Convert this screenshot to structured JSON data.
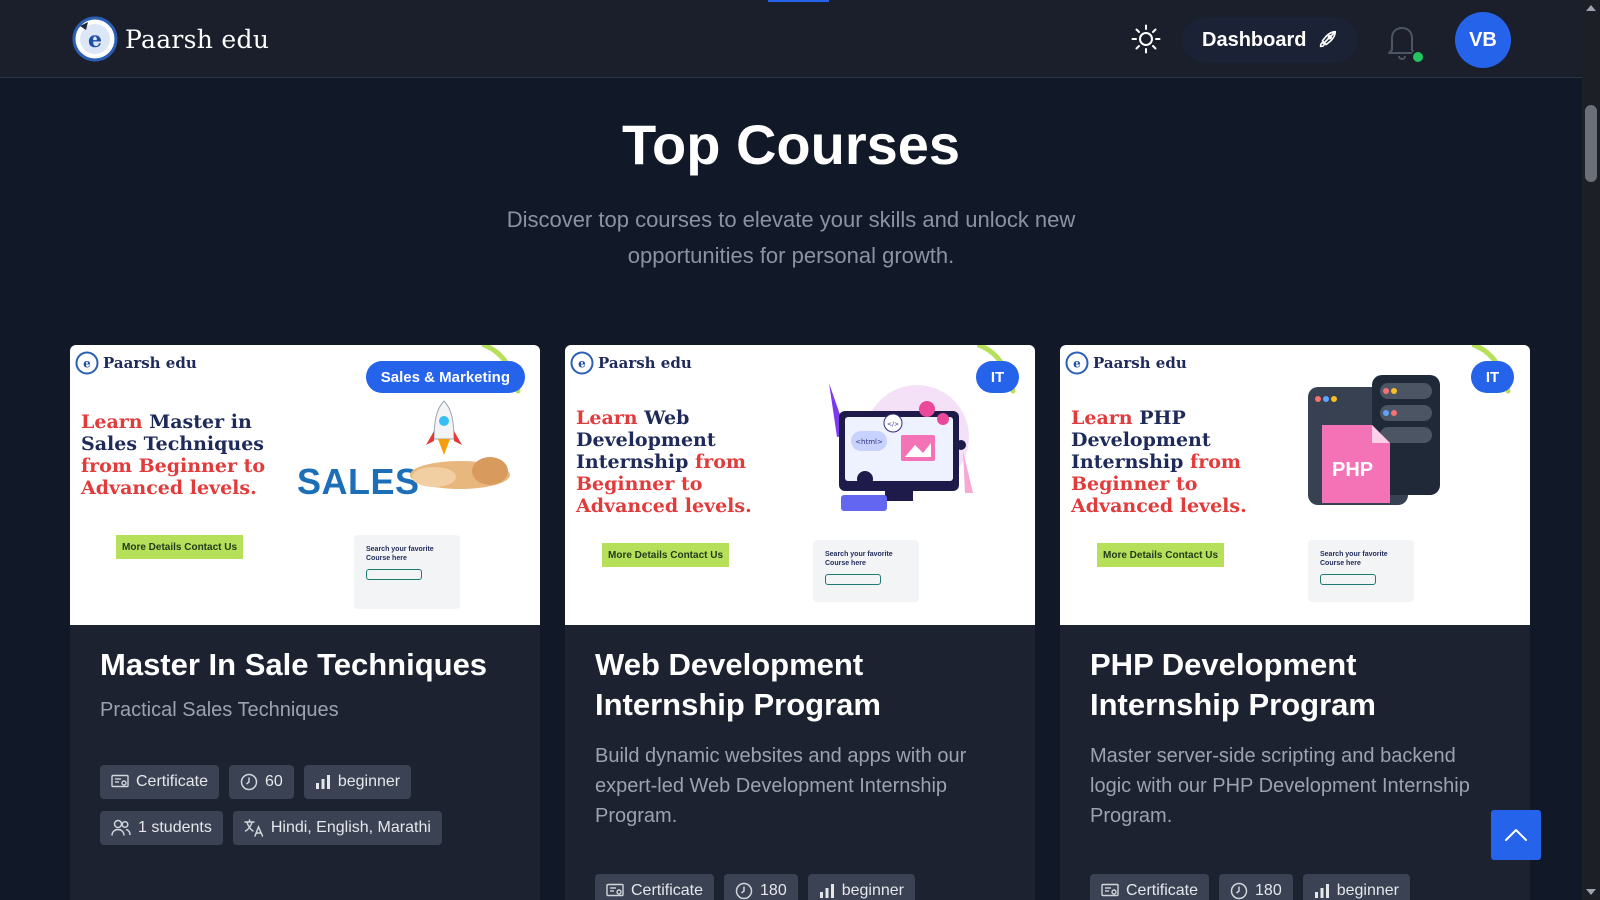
{
  "header": {
    "logo_text": "Paarsh edu",
    "dashboard_label": "Dashboard",
    "avatar_initials": "VB",
    "icons": {
      "theme": "sun-icon",
      "dashboard": "rocket-icon",
      "notifications": "bell-icon"
    },
    "notification_status_color": "#22c55e"
  },
  "hero": {
    "title": "Top Courses",
    "subtitle": "Discover top courses to elevate your skills and unlock new opportunities for personal growth."
  },
  "courses": [
    {
      "category": "Sales & Marketing",
      "thumb_logo": "Paarsh edu",
      "thumb_headline": {
        "learn": "Learn",
        "subject": "Master in Sales Techniques",
        "from": "from",
        "rest": "Beginner to Advanced levels."
      },
      "thumb_word": "SALES",
      "thumb_cta": "More Details Contact Us",
      "thumb_search": "Search your favorite Course here",
      "title": "Master In Sale Techniques",
      "description": "Practical Sales Techniques",
      "certificate": "Certificate",
      "duration": "60",
      "level": "beginner",
      "students": "1 students",
      "languages": "Hindi, English, Marathi"
    },
    {
      "category": "IT",
      "thumb_logo": "Paarsh edu",
      "thumb_headline": {
        "learn": "Learn",
        "subject": "Web Development Internship",
        "from": "from",
        "rest": "Beginner to Advanced levels."
      },
      "thumb_cta": "More Details Contact Us",
      "thumb_search": "Search your favorite Course here",
      "title": "Web Development Internship Program",
      "description": "Build dynamic websites and apps with our expert-led Web Development Internship Program.",
      "certificate": "Certificate",
      "duration": "180",
      "level": "beginner"
    },
    {
      "category": "IT",
      "thumb_logo": "Paarsh edu",
      "thumb_headline": {
        "learn": "Learn",
        "subject": "PHP Development Internship",
        "from": "from",
        "rest": "Beginner to Advanced levels."
      },
      "thumb_cta": "More Details Contact Us",
      "thumb_search": "Search your favorite Course here",
      "thumb_file_label": "PHP",
      "title": "PHP Development Internship Program",
      "description": "Master server-side scripting and backend logic with our PHP Development Internship Program.",
      "certificate": "Certificate",
      "duration": "180",
      "level": "beginner"
    }
  ],
  "colors": {
    "background": "#111827",
    "header": "#1a1f2b",
    "accent": "#2563eb",
    "card": "#1c2230",
    "chip": "#3a4253"
  }
}
